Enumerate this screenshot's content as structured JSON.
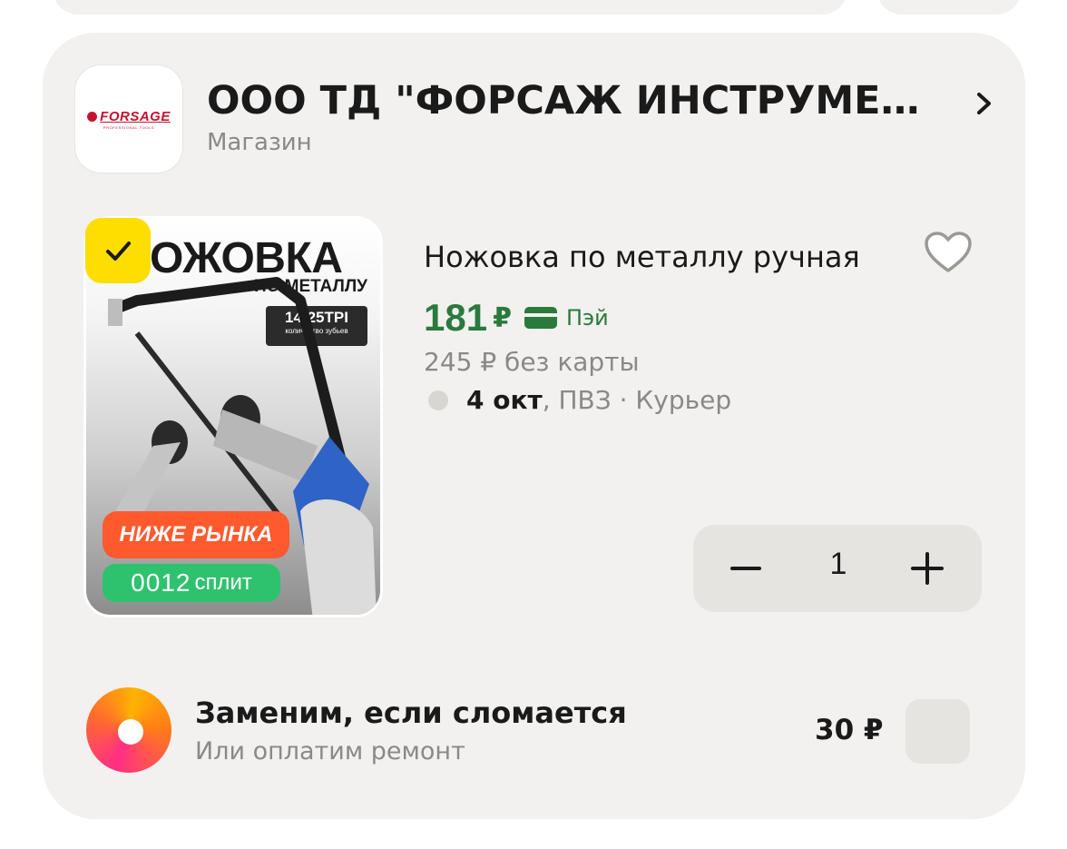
{
  "store": {
    "logo_text": "FORSAGE",
    "logo_subtext": "PROFESSIONAL TOOLS",
    "name": "ООО ТД \"ФОРСАЖ ИНСТРУМЕНТ...",
    "subtitle": "Магазин"
  },
  "product": {
    "image": {
      "title": "ОЖОВКА",
      "subtitle": "ПО МЕТАЛЛУ",
      "tpi": "14-25TPI",
      "tpi_caption": "количество зубьев",
      "badge_price": "НИЖЕ РЫНКА",
      "badge_split_number": "0012",
      "badge_split_label": "сплит"
    },
    "selected": true,
    "title": "Ножовка по металлу ручная",
    "price": "181",
    "currency": "₽",
    "pay_method": "Пэй",
    "old_price": "245 ₽ без карты",
    "delivery_date": "4 окт",
    "delivery_rest": ", ПВЗ · Курьер",
    "quantity": "1"
  },
  "service": {
    "title": "Заменим, если сломается",
    "subtitle": "Или оплатим ремонт",
    "price": "30 ₽"
  },
  "colors": {
    "card_bg": "#f2f1ef",
    "price_green": "#2b7a3d",
    "badge_yellow": "#fedd00",
    "muted_text": "#8a8986"
  },
  "icons": {
    "check": "check-icon",
    "heart": "heart-outline-icon",
    "chevron": "chevron-right-icon",
    "card": "card-icon",
    "minus": "minus-icon",
    "plus": "plus-icon"
  }
}
